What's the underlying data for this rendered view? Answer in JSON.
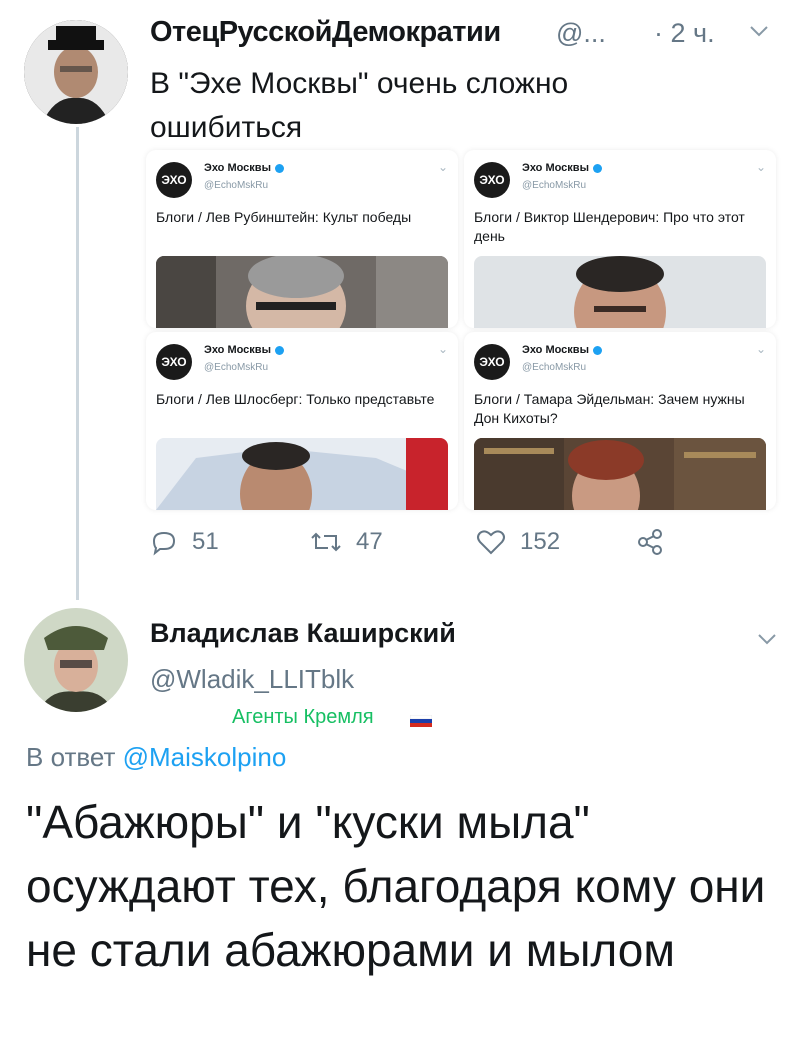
{
  "tweet1": {
    "display_name": "ОтецРусскойДемократии",
    "handle": "@...",
    "time": "· 2 ч.",
    "chevron_icon": "chevron-down-icon",
    "text": "В \"Эхе Москвы\" очень сложно ошибиться",
    "quoted_cards": [
      {
        "account_name": "Эхо Москвы",
        "account_handle": "@EchoMskRu",
        "logo_text": "ЭХО",
        "text": "Блоги / Лев Рубинштейн: Культ победы"
      },
      {
        "account_name": "Эхо Москвы",
        "account_handle": "@EchoMskRu",
        "logo_text": "ЭХО",
        "text": "Блоги / Виктор Шендерович: Про что этот день"
      },
      {
        "account_name": "Эхо Москвы",
        "account_handle": "@EchoMskRu",
        "logo_text": "ЭХО",
        "text": "Блоги / Лев Шлосберг: Только представьте"
      },
      {
        "account_name": "Эхо Москвы",
        "account_handle": "@EchoMskRu",
        "logo_text": "ЭХО",
        "text": "Блоги / Тамара Эйдельман: Зачем нужны Дон Кихоты?"
      }
    ],
    "actions": {
      "reply_count": "51",
      "retweet_count": "47",
      "like_count": "152"
    }
  },
  "tweet2": {
    "display_name": "Владислав Каширский",
    "handle": "@Wladik_LLITblk",
    "tag": "Агенты Кремля",
    "reply_prefix": "В ответ",
    "reply_mention": "@Maiskolpino",
    "text": "\"Абажюры\" и \"куски мыла\" осуждают тех, благодаря кому они не стали абажюрами и мылом"
  },
  "colors": {
    "link": "#1da1f2",
    "muted": "#657786",
    "tag": "#17bf63"
  }
}
